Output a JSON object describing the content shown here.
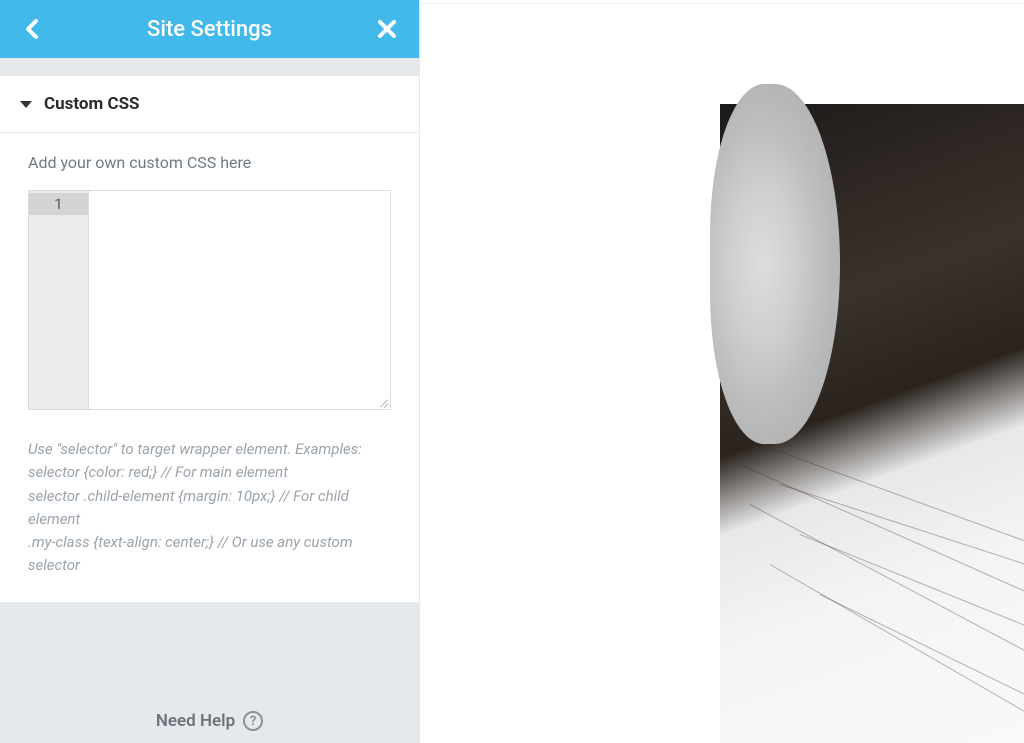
{
  "header": {
    "title": "Site Settings"
  },
  "section": {
    "title": "Custom CSS",
    "field_label": "Add your own custom CSS here",
    "editor": {
      "line_number": "1",
      "value": ""
    },
    "help_text": "Use \"selector\" to target wrapper element. Examples:\nselector {color: red;} // For main element\nselector .child-element {margin: 10px;} // For child element\n.my-class {text-align: center;} // Or use any custom selector"
  },
  "footer": {
    "need_help": "Need Help"
  }
}
